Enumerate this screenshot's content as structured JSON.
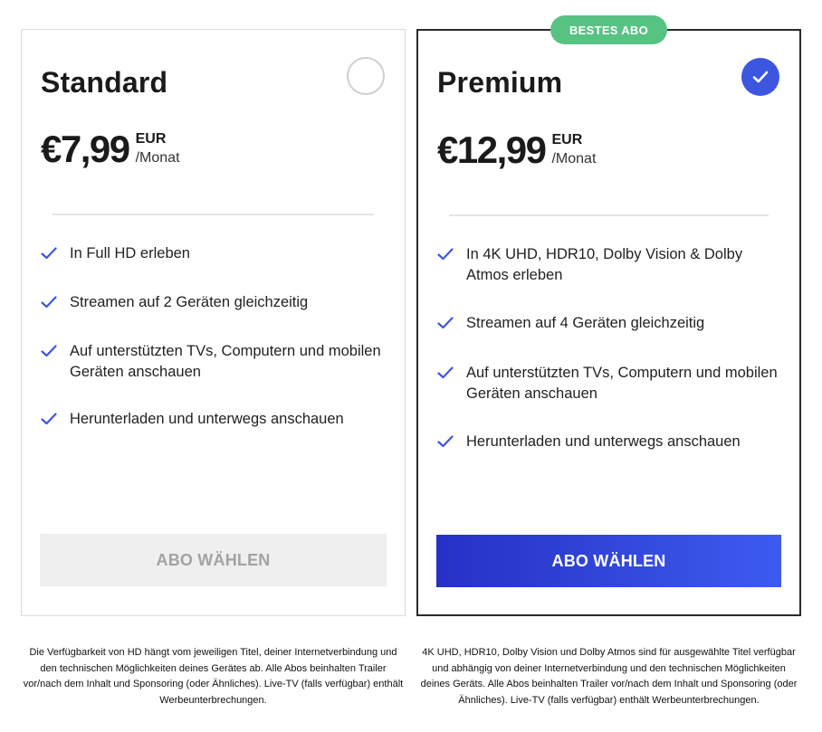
{
  "colors": {
    "accent": "#3d56e0",
    "badge": "#56c383",
    "check": "#3d56e0",
    "cta_primary_start": "#2631c4",
    "cta_primary_end": "#3d5bf0",
    "cta_disabled_bg": "#efefef",
    "cta_disabled_text": "#a3a3a3"
  },
  "plans": [
    {
      "name": "Standard",
      "selected": false,
      "price": "€7,99",
      "currency": "EUR",
      "period": "/Monat",
      "features": [
        "In Full HD erleben",
        "Streamen auf 2 Geräten gleichzeitig",
        "Auf unterstützten TVs, Computern und mobilen Geräten anschauen",
        "Herunterladen und unterwegs anschauen"
      ],
      "cta_label": "ABO WÄHLEN",
      "cta_state": "disabled",
      "footnote": "Die Verfügbarkeit von HD hängt vom jeweiligen Titel, deiner Internetverbindung und den technischen Möglichkeiten deines Gerätes ab. Alle Abos beinhalten Trailer vor/nach dem Inhalt und Sponsoring (oder Ähnliches). Live-TV (falls verfügbar) enthält Werbeunterbrechungen."
    },
    {
      "name": "Premium",
      "badge": "BESTES ABO",
      "selected": true,
      "price": "€12,99",
      "currency": "EUR",
      "period": "/Monat",
      "features": [
        "In 4K UHD, HDR10, Dolby Vision & Dolby Atmos erleben",
        "Streamen auf 4 Geräten gleichzeitig",
        "Auf unterstützten TVs, Computern und mobilen Geräten anschauen",
        "Herunterladen und unterwegs anschauen"
      ],
      "cta_label": "ABO WÄHLEN",
      "cta_state": "active",
      "footnote": "4K UHD, HDR10, Dolby Vision und Dolby Atmos sind für ausgewählte Titel verfügbar und abhängig von deiner Internetverbindung und den technischen Möglichkeiten deines Geräts. Alle Abos beinhalten Trailer vor/nach dem Inhalt und Sponsoring (oder Ähnliches). Live-TV (falls verfügbar) enthält Werbeunterbrechungen."
    }
  ]
}
